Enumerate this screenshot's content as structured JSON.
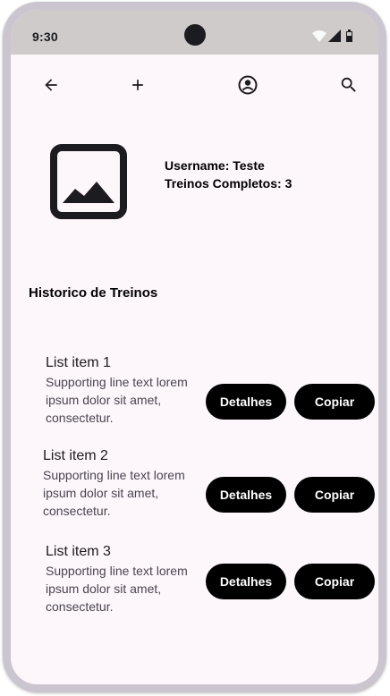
{
  "status_bar": {
    "time": "9:30"
  },
  "toolbar": {
    "back_icon": "arrow-back-icon",
    "add_icon": "add-icon",
    "account_icon": "account-circle-icon",
    "search_icon": "search-icon"
  },
  "profile": {
    "image_icon": "image-placeholder-icon",
    "username_line": "Username: Teste",
    "completed_line": "Treinos Completos: 3"
  },
  "history": {
    "title": "Historico de Treinos",
    "items": [
      {
        "headline": "List item 1",
        "support": "Supporting line text lorem ipsum dolor sit amet, consectetur.",
        "details_label": "Detalhes",
        "copy_label": "Copiar"
      },
      {
        "headline": "List item 2",
        "support": "Supporting line text lorem ipsum dolor sit amet, consectetur.",
        "details_label": "Detalhes",
        "copy_label": "Copiar"
      },
      {
        "headline": "List item 3",
        "support": "Supporting line text lorem ipsum dolor sit amet, consectetur.",
        "details_label": "Detalhes",
        "copy_label": "Copiar"
      }
    ]
  },
  "colors": {
    "screen_background": "#fdf7fc",
    "status_bar": "#cfcbcb",
    "frame": "#cbc5cf",
    "button_background": "#000000",
    "button_text": "#ffffff"
  }
}
